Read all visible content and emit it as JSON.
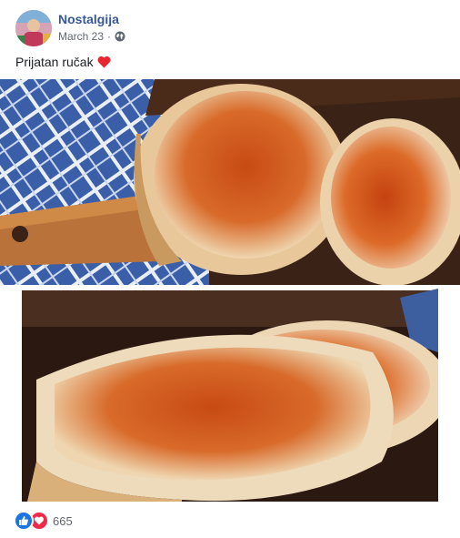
{
  "post": {
    "author": "Nostalgija",
    "date": "March 23",
    "separator": "·",
    "privacy_icon": "globe-icon",
    "caption": "Prijatan ručak",
    "caption_emoji": "red-heart-emoji",
    "reactions": {
      "icons": [
        "like-icon",
        "love-icon"
      ],
      "count": "665"
    }
  },
  "colors": {
    "author_link": "#385898",
    "meta_text": "#616770",
    "like_blue": "#1b74e4",
    "love_red": "#f0284a",
    "heart": "#e8262f"
  }
}
